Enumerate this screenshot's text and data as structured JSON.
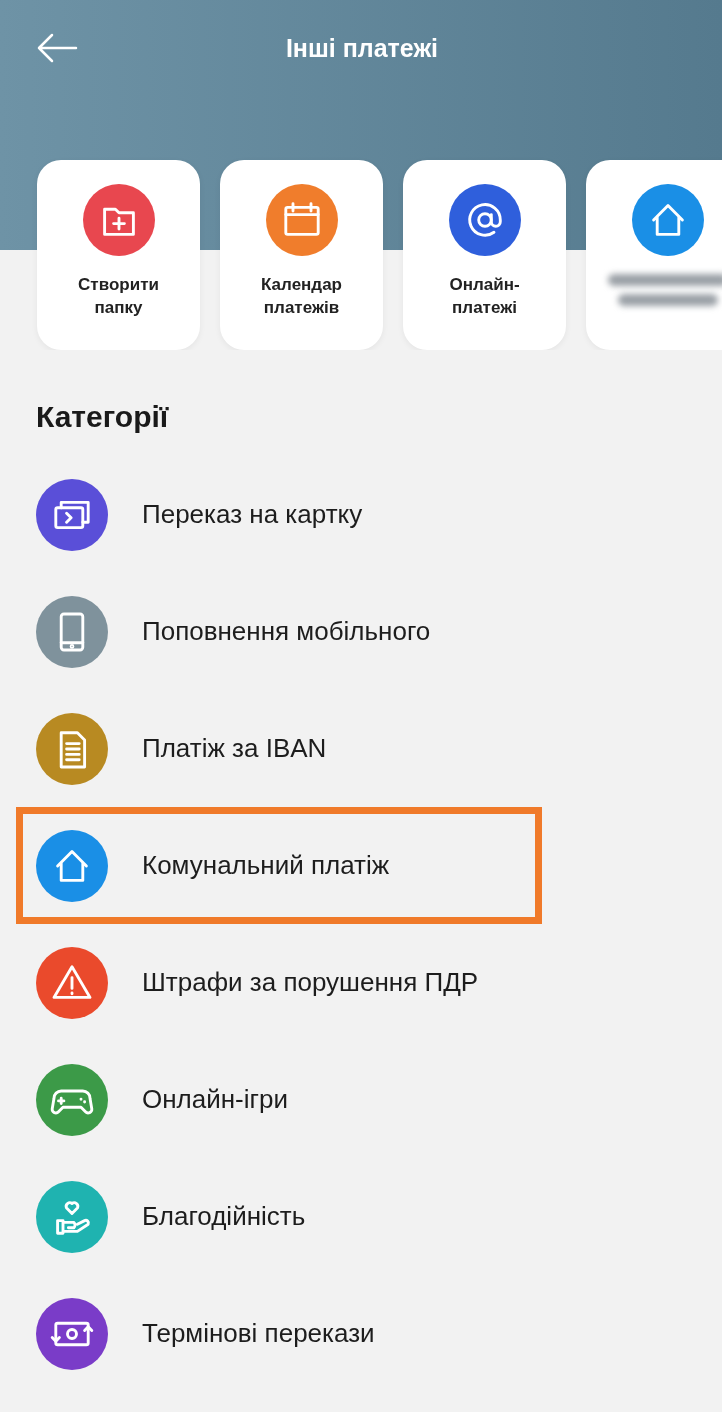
{
  "header": {
    "title": "Інші платежі"
  },
  "quick_actions": [
    {
      "kind": "folder",
      "color": "#e8474f",
      "label": "Створити\nпапку"
    },
    {
      "kind": "calendar",
      "color": "#f07d2c",
      "label": "Календар\nплатежів"
    },
    {
      "kind": "at",
      "color": "#2f5fdc",
      "label": "Онлайн-\nплатежі"
    },
    {
      "kind": "home",
      "color": "#1a8fe6",
      "blurred": true
    }
  ],
  "categories_title": "Категорії",
  "categories": [
    {
      "kind": "card",
      "color": "#5a4fd8",
      "label": "Переказ на картку",
      "highlighted": false
    },
    {
      "kind": "phone",
      "color": "#7f929c",
      "label": "Поповнення мобільного",
      "highlighted": false
    },
    {
      "kind": "document",
      "color": "#b88a22",
      "label": "Платіж за IBAN",
      "highlighted": false
    },
    {
      "kind": "home",
      "color": "#1a8fe6",
      "label": "Комунальний платіж",
      "highlighted": true
    },
    {
      "kind": "warning",
      "color": "#ea4a2c",
      "label": "Штрафи за порушення ПДР",
      "highlighted": false
    },
    {
      "kind": "gamepad",
      "color": "#3c9a48",
      "label": "Онлайн-ігри",
      "highlighted": false
    },
    {
      "kind": "charity",
      "color": "#1fb3b0",
      "label": "Благодійність",
      "highlighted": false
    },
    {
      "kind": "exchange",
      "color": "#7a3cc8",
      "label": "Термінові перекази",
      "highlighted": false
    }
  ]
}
